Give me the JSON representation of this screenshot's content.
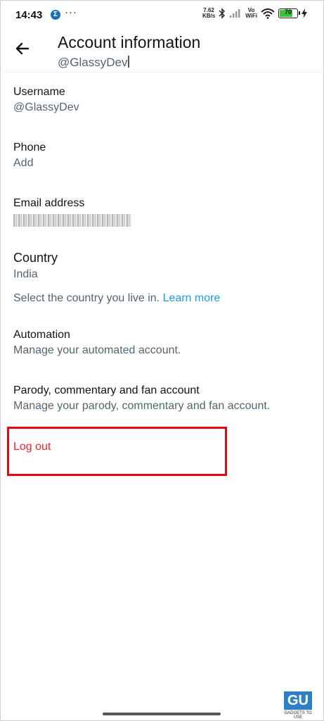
{
  "status_bar": {
    "time": "14:43",
    "app_icon_letter": "Σ",
    "more": "···",
    "speed_value": "7.62",
    "speed_unit": "KB/s",
    "volte_top": "Vo",
    "volte_bottom": "WiFi",
    "battery": "70"
  },
  "header": {
    "title": "Account information",
    "subtitle": "@GlassyDev"
  },
  "settings": {
    "username": {
      "label": "Username",
      "value": "@GlassyDev"
    },
    "phone": {
      "label": "Phone",
      "value": "Add"
    },
    "email": {
      "label": "Email address"
    },
    "country": {
      "label": "Country",
      "value": "India",
      "hint": "Select the country you live in.",
      "hint_link": "Learn more"
    },
    "automation": {
      "label": "Automation",
      "value": "Manage your automated account."
    },
    "parody": {
      "label": "Parody, commentary and fan account",
      "value": "Manage your parody, commentary and fan account."
    }
  },
  "logout": {
    "label": "Log out"
  },
  "watermark": {
    "logo": "GU",
    "text": "GADGETS TO USE"
  },
  "colors": {
    "accent_link": "#1d9bf0",
    "danger": "#f4212e",
    "highlight_box": "#e30613"
  }
}
